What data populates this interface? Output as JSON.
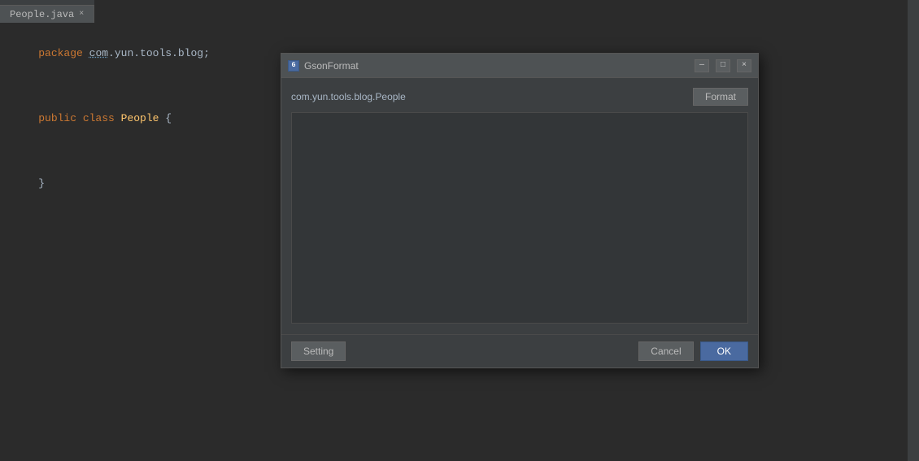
{
  "tab": {
    "label": "People.java",
    "close": "×"
  },
  "code": {
    "line1": "package com.yun.tools.blog;",
    "line1_pkg": "com",
    "line1_rest": ".yun.tools.blog;",
    "line2": "",
    "line3_kw1": "public",
    "line3_kw2": "class",
    "line3_name": "People",
    "line3_brace": "{",
    "line4": "",
    "line5_brace": "}"
  },
  "dialog": {
    "title": "GsonFormat",
    "title_icon": "G",
    "classname": "com.yun.tools.blog.People",
    "format_label": "Format",
    "json_placeholder": "",
    "setting_label": "Setting",
    "cancel_label": "Cancel",
    "ok_label": "OK",
    "titlebar_buttons": {
      "minimize": "—",
      "maximize": "□",
      "close": "×"
    }
  }
}
